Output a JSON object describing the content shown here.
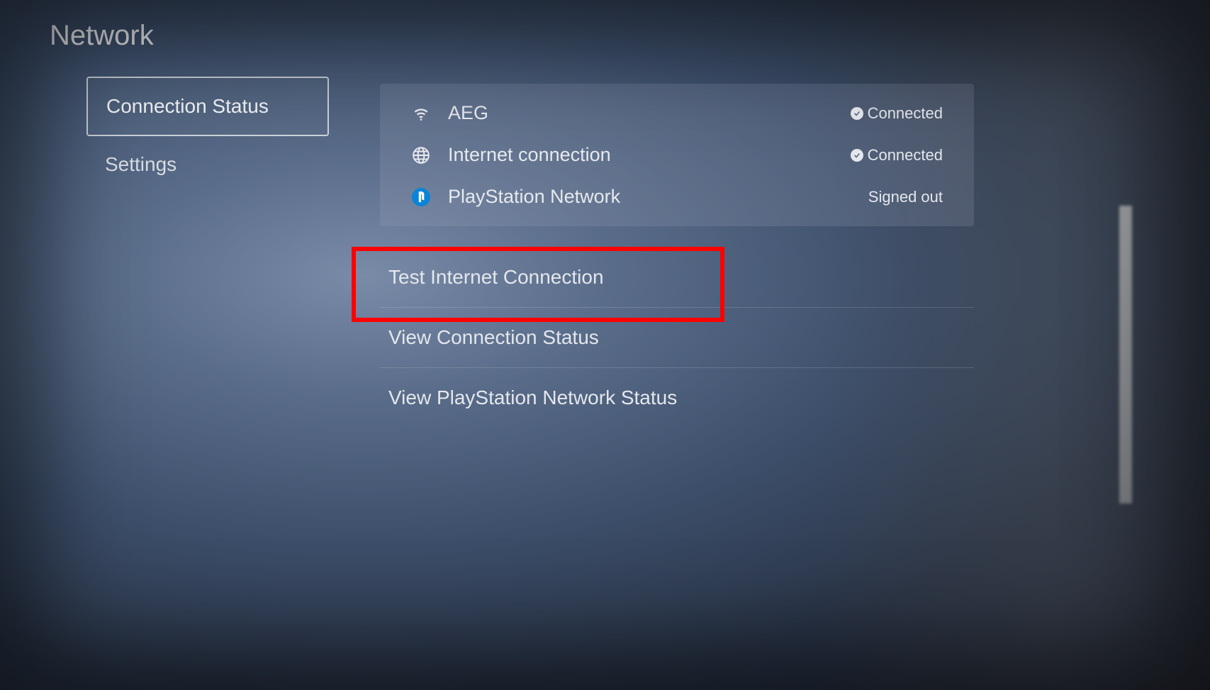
{
  "page_title": "Network",
  "sidebar": {
    "items": [
      {
        "label": "Connection Status",
        "selected": true
      },
      {
        "label": "Settings",
        "selected": false
      }
    ]
  },
  "status": {
    "rows": [
      {
        "icon": "wifi",
        "label": "AEG",
        "value": "Connected",
        "has_check": true
      },
      {
        "icon": "globe",
        "label": "Internet connection",
        "value": "Connected",
        "has_check": true
      },
      {
        "icon": "psn",
        "label": "PlayStation Network",
        "value": "Signed out",
        "has_check": false
      }
    ]
  },
  "actions": [
    {
      "label": "Test Internet Connection",
      "highlighted": true
    },
    {
      "label": "View Connection Status",
      "highlighted": false
    },
    {
      "label": "View PlayStation Network Status",
      "highlighted": false
    }
  ]
}
